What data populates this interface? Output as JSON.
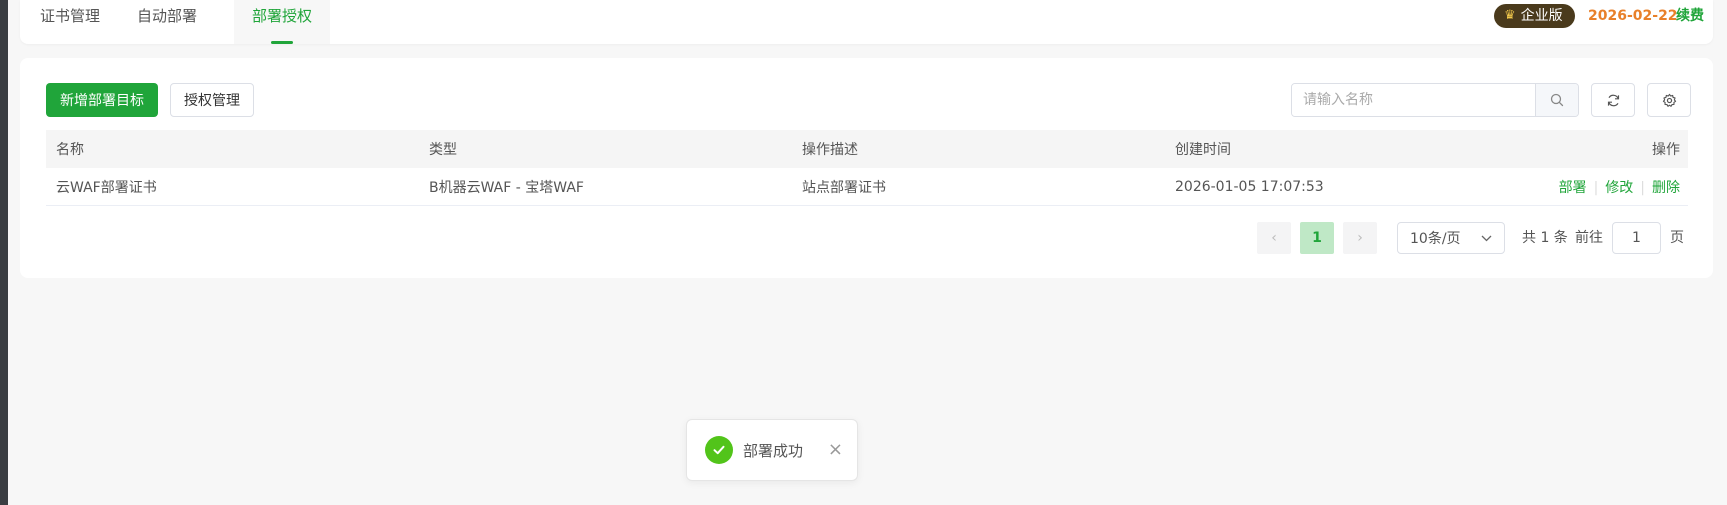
{
  "tabs": [
    {
      "label": "证书管理"
    },
    {
      "label": "自动部署"
    },
    {
      "label": "部署授权"
    }
  ],
  "header": {
    "edition_label": "企业版",
    "expire_date": "2026-02-22",
    "renew_label": "续费"
  },
  "toolbar": {
    "add_target_label": "新增部署目标",
    "auth_manage_label": "授权管理",
    "search_placeholder": "请输入名称"
  },
  "table": {
    "columns": [
      "名称",
      "类型",
      "操作描述",
      "创建时间",
      "操作"
    ],
    "rows": [
      {
        "name": "云WAF部署证书",
        "type": "B机器云WAF - 宝塔WAF",
        "description": "站点部署证书",
        "created": "2026-01-05 17:07:53",
        "actions": [
          "部署",
          "修改",
          "删除"
        ]
      }
    ]
  },
  "pagination": {
    "current_page": "1",
    "page_size": "10条/页",
    "total_text": "共 1 条",
    "goto_label": "前往",
    "goto_value": "1",
    "page_unit": "页"
  },
  "toast": {
    "message": "部署成功"
  },
  "colors": {
    "accent": "#20a53a",
    "expire": "#e8802a",
    "success": "#52c41a"
  }
}
